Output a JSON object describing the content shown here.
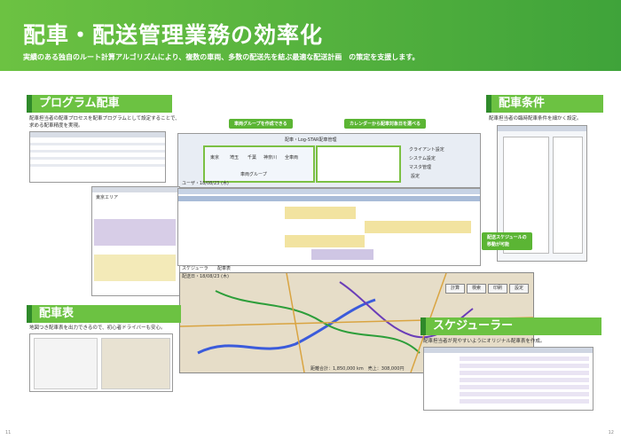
{
  "header": {
    "title": "配車・配送管理業務の効率化",
    "subtitle": "実績のある独自のルート計算アルゴリズムにより、複数の車両、多数の配送先を結ぶ最適な配送計画　の策定を支援します。"
  },
  "sections": {
    "program": {
      "title": "プログラム配車",
      "desc1": "配車担当者の配車プロセスを配車プログラムとして設定することで、",
      "desc2": "求める配車精度を実現。"
    },
    "conditions": {
      "title": "配車条件",
      "desc": "配車担当者の臨時配車条件を細かく設定。"
    },
    "table": {
      "title": "配車表",
      "desc": "地図つき配車表を出力できるので、初心者ドライバーも安心。"
    },
    "scheduler": {
      "title": "スケジューラー",
      "desc": "配車担当者が見やすいようにオリジナル配車表を作成。"
    }
  },
  "callouts": {
    "group": "車両グループを作成できる",
    "calendar": "カレンダーから配車対象日を選べる",
    "schedule1": "配送スケジュールの",
    "schedule2": "移動が可能"
  },
  "app": {
    "window_title": "配車・Log-STAR配車管理",
    "area_label": "車両グループ",
    "date_label": "ユーザ・18/08/23 (木)",
    "menu_client": "クライアント設定",
    "menu_system": "システム設定",
    "menu_master": "マスタ管理",
    "menu_settings": "設定",
    "tab_scheduler": "スケジューラ",
    "tab_table": "配車表",
    "map_date": "配送日・18/08/23 (木)",
    "btn_calc": "計算",
    "btn_search": "検索",
    "btn_print": "印刷",
    "btn_settings": "設定",
    "status": "距離合計：1,850,000 km　売上：308,000円",
    "ward_label": "東京エリア",
    "groups": [
      "東京",
      "埼玉",
      "千葉",
      "神奈川",
      "全車両"
    ]
  },
  "pages": {
    "left": "11",
    "right": "12"
  }
}
